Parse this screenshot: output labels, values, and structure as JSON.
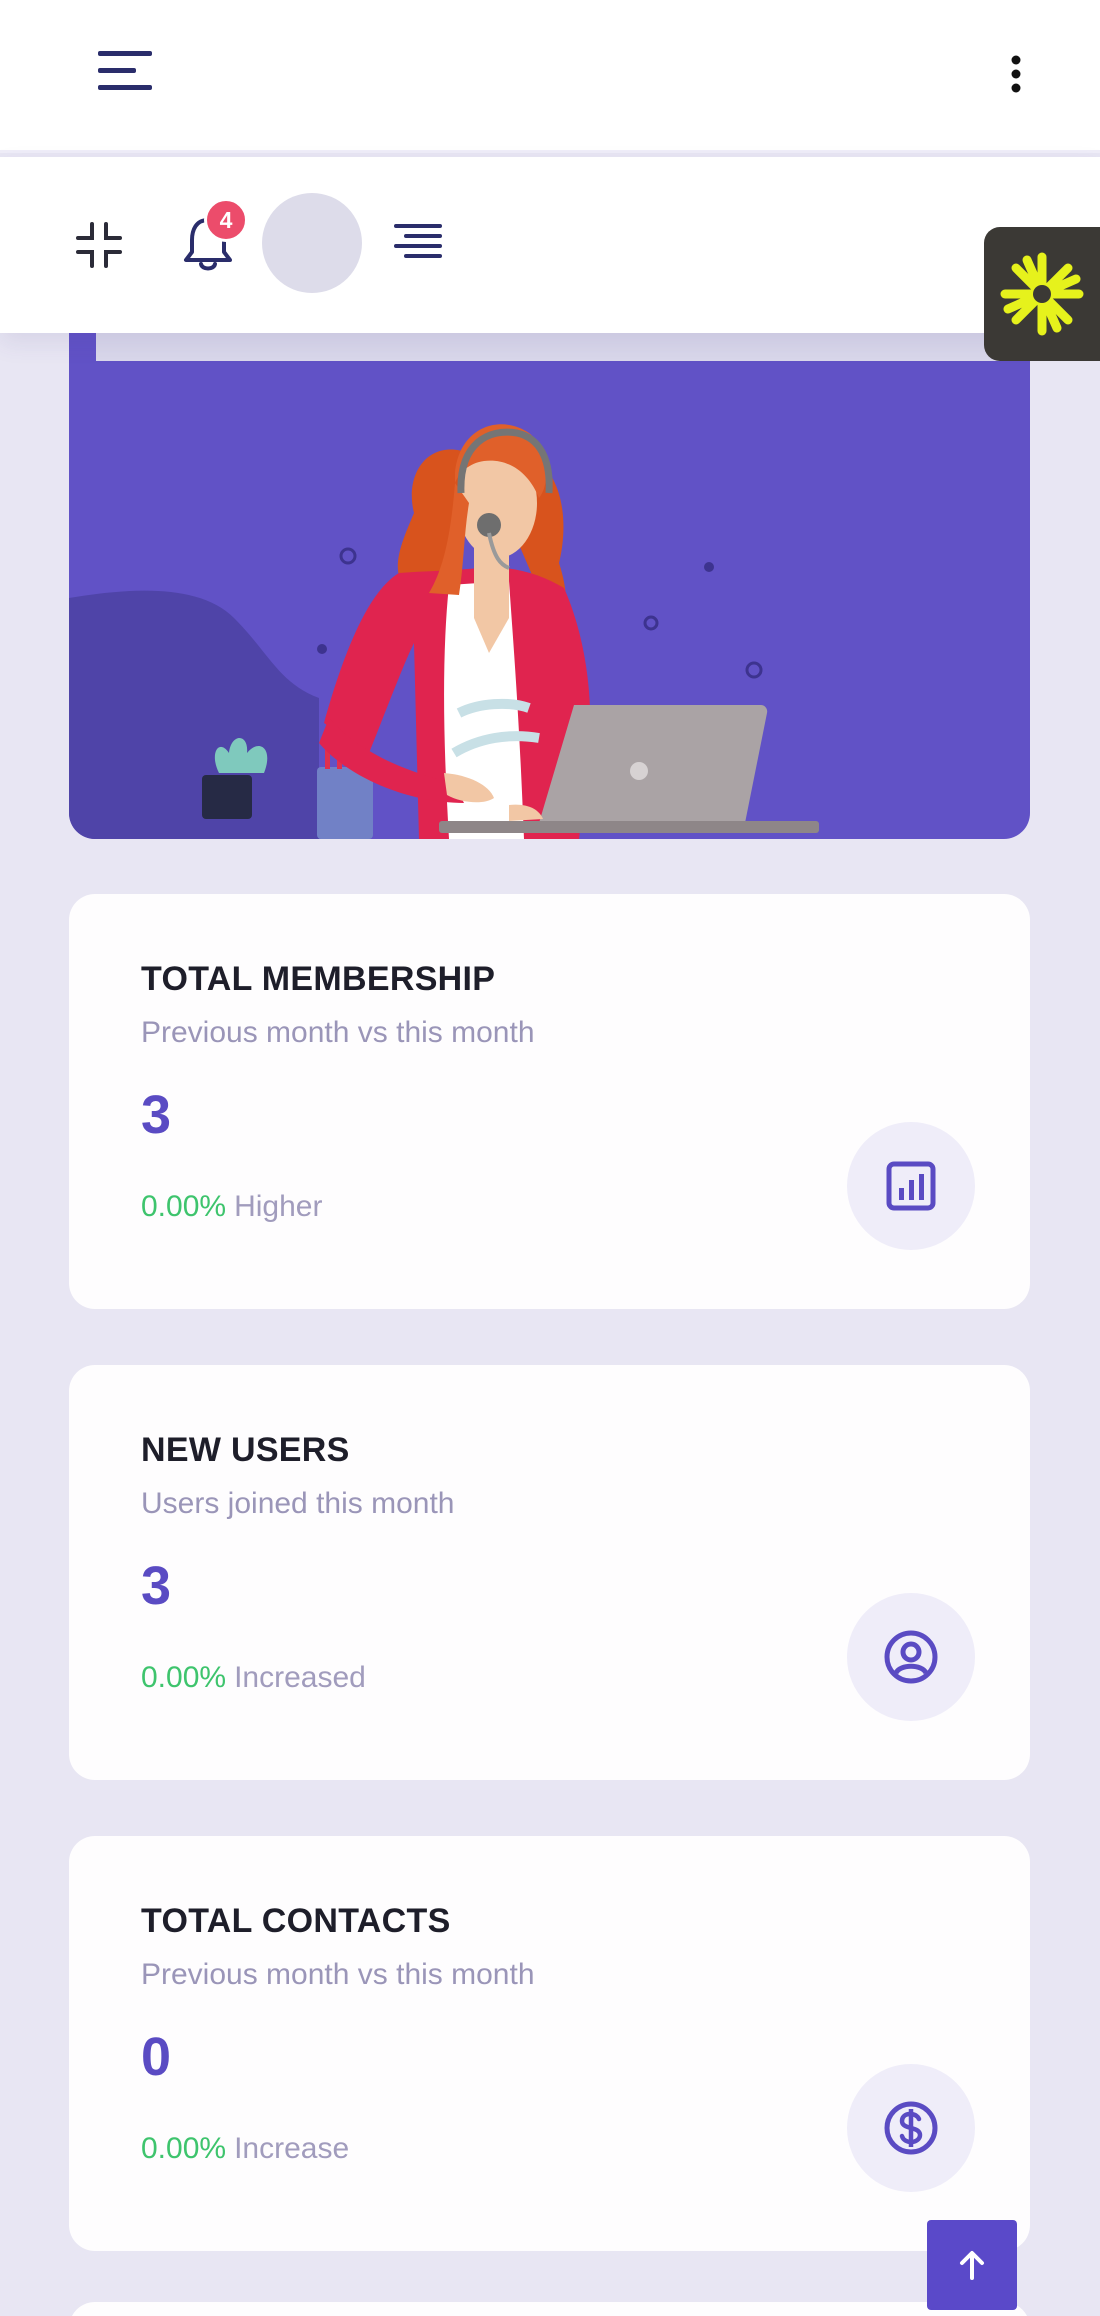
{
  "header": {
    "menu_icon": "hamburger-icon",
    "more_icon": "vertical-dots-icon"
  },
  "toolbar": {
    "fullscreen_icon": "collapse-icon",
    "notification_icon": "bell-icon",
    "notification_count": "4",
    "avatar": "user-avatar",
    "align_icon": "align-right-icon",
    "widget_icon": "sparkle-icon"
  },
  "hero": {
    "illustration": "support-agent-illustration"
  },
  "cards": [
    {
      "title": "TOTAL MEMBERSHIP",
      "subtitle": "Previous month vs this month",
      "value": "3",
      "percent": "0.00%",
      "change_label": "Higher",
      "icon": "bar-chart-icon"
    },
    {
      "title": "NEW USERS",
      "subtitle": "Users joined this month",
      "value": "3",
      "percent": "0.00%",
      "change_label": "Increased",
      "icon": "user-circle-icon"
    },
    {
      "title": "TOTAL CONTACTS",
      "subtitle": "Previous month vs this month",
      "value": "0",
      "percent": "0.00%",
      "change_label": "Increase",
      "icon": "dollar-icon"
    }
  ],
  "scroll_top_icon": "arrow-up-icon",
  "colors": {
    "accent": "#5a4bc3",
    "hero": "#6152c6",
    "positive": "#3ec46d",
    "badge": "#ec4c6b",
    "background": "#e8e6f3"
  }
}
